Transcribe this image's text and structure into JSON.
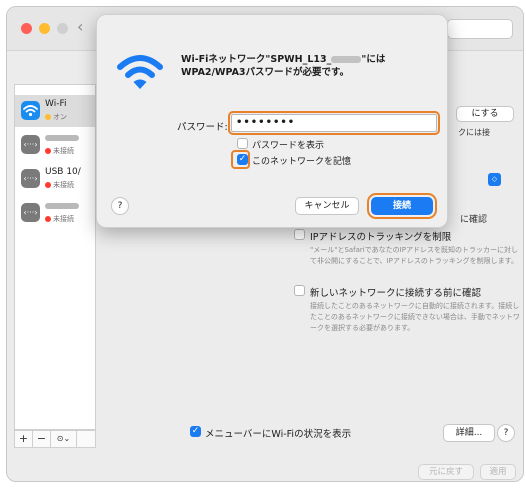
{
  "sidebar": {
    "items": [
      {
        "name": "Wi-Fi",
        "status": "オン",
        "icon": "wifi-icon"
      },
      {
        "name": "",
        "status": "未接続",
        "icon": "ethernet-icon",
        "name_redacted": true
      },
      {
        "name": "USB 10/",
        "status": "未接続",
        "icon": "ethernet-icon"
      },
      {
        "name": "",
        "status": "未接続",
        "icon": "ethernet-icon",
        "name_redacted": true
      }
    ],
    "controls": {
      "add": "+",
      "remove": "−",
      "more": "⊙⌄"
    }
  },
  "main": {
    "wifi_off_button": "にする",
    "fragment_auto_join": "クには接",
    "fragment_ask": "に確認",
    "ip_tracking": {
      "label": "IPアドレスのトラッキングを制限",
      "desc": "\"メール\"とSafariであなたのIPアドレスを既知のトラッカーに対して非公開にすることで、IPアドレスのトラッキングを制限します。"
    },
    "ask_new_network": {
      "label": "新しいネットワークに接続する前に確認",
      "desc": "接続したことのあるネットワークに自動的に接続されます。接続したことのあるネットワークに接続できない場合は、手動でネットワークを選択する必要があります。"
    },
    "menubar_status": {
      "label": "メニューバーにWi-Fiの状況を表示",
      "checked": true
    },
    "details_button": "詳細...",
    "help_button": "?",
    "revert_button": "元に戻す",
    "apply_button": "適用"
  },
  "dialog": {
    "title_prefix": "Wi-Fiネットワーク\"SPWH_L13_",
    "title_suffix": "\"にはWPA2/WPA3パスワードが必要です。",
    "password_label": "パスワード:",
    "password_value": "••••••••",
    "show_password": {
      "label": "パスワードを表示",
      "checked": false
    },
    "remember_network": {
      "label": "このネットワークを記憶",
      "checked": true
    },
    "help": "?",
    "cancel": "キャンセル",
    "connect": "接続"
  },
  "colors": {
    "accent": "#1a7bf2",
    "highlight": "#e8822a",
    "status_off": "#ff3b30",
    "status_on": "#febc2e"
  }
}
